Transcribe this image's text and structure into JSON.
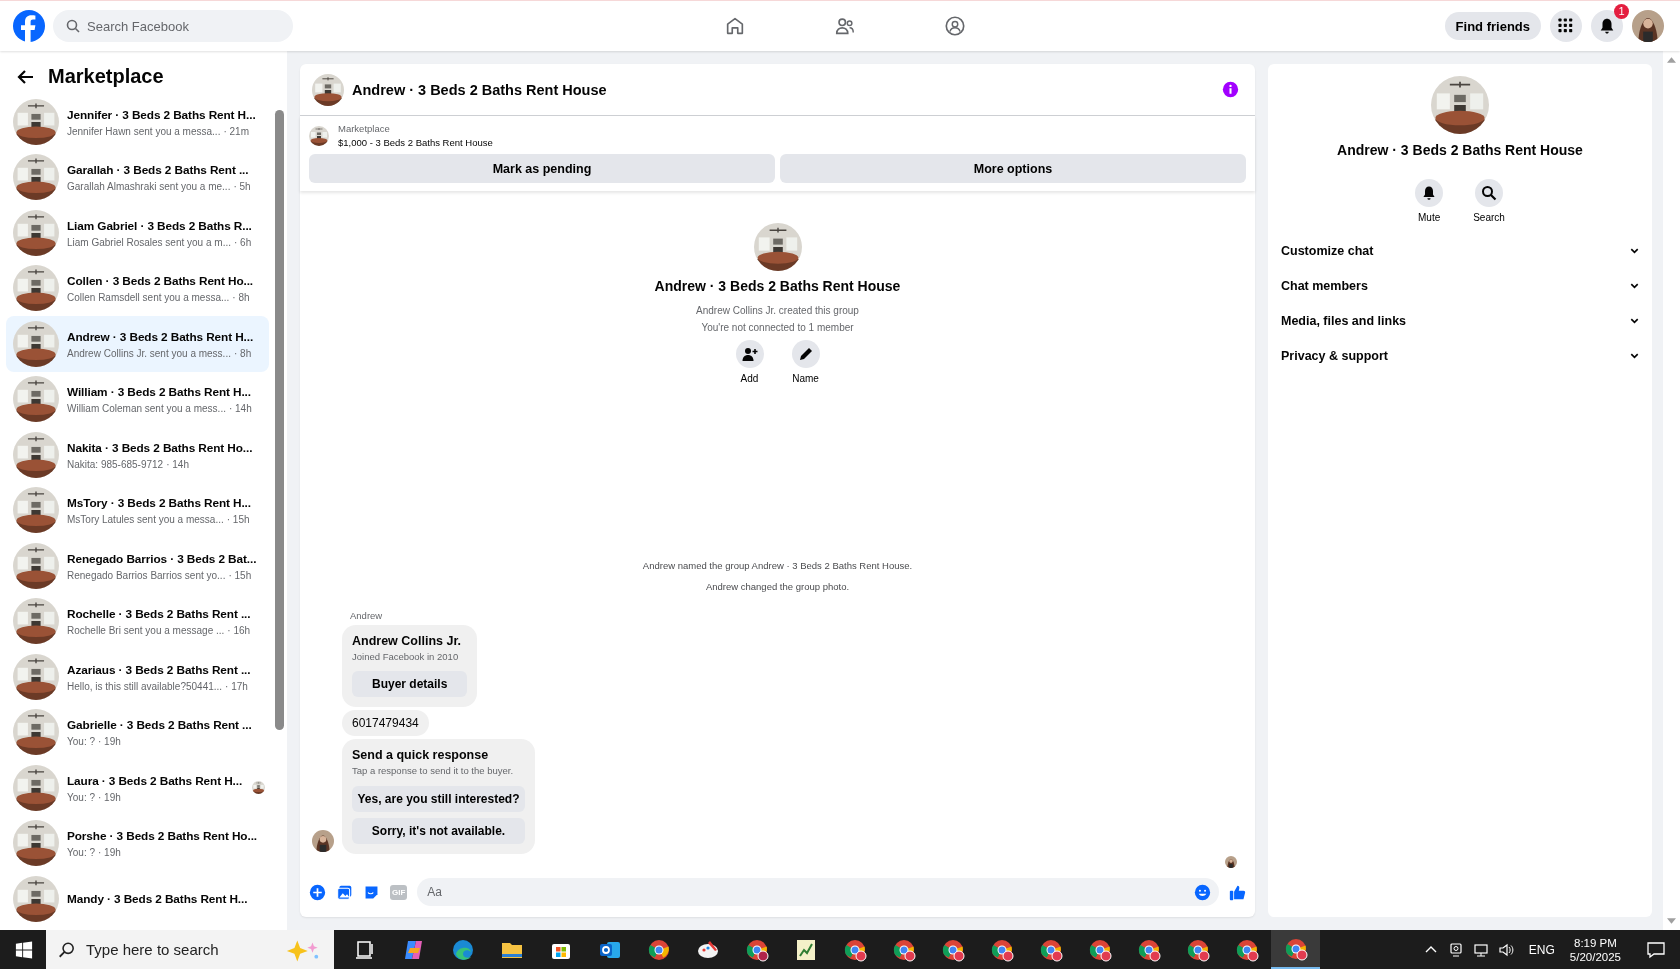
{
  "top_bar": {
    "search": {
      "placeholder": "Search Facebook"
    },
    "find_friends": "Find friends",
    "notification_count": "1"
  },
  "sidebar": {
    "title": "Marketplace",
    "conversations": [
      {
        "name": "Jennifer · 3 Beds 2 Baths Rent H...",
        "preview": "Jennifer Hawn sent you a messa...",
        "time": "· 21m",
        "selected": false,
        "seen_avatar": false
      },
      {
        "name": "Garallah · 3 Beds 2 Baths Rent ...",
        "preview": "Garallah Almashraki sent you a me...",
        "time": "· 5h",
        "selected": false,
        "seen_avatar": false
      },
      {
        "name": "Liam Gabriel · 3 Beds 2 Baths R...",
        "preview": "Liam Gabriel Rosales sent you a m...",
        "time": "· 6h",
        "selected": false,
        "seen_avatar": false
      },
      {
        "name": "Collen · 3 Beds 2 Baths Rent Ho...",
        "preview": "Collen Ramsdell sent you a messa...",
        "time": "· 8h",
        "selected": false,
        "seen_avatar": false
      },
      {
        "name": "Andrew · 3 Beds 2 Baths Rent H...",
        "preview": "Andrew Collins Jr. sent you a mess...",
        "time": "· 8h",
        "selected": true,
        "seen_avatar": false
      },
      {
        "name": "William · 3 Beds 2 Baths Rent H...",
        "preview": "William Coleman sent you a mess...",
        "time": "· 14h",
        "selected": false,
        "seen_avatar": false
      },
      {
        "name": "Nakita · 3 Beds 2 Baths Rent Ho...",
        "preview": "Nakita: 985-685-9712",
        "time": "· 14h",
        "selected": false,
        "seen_avatar": false
      },
      {
        "name": "MsTory · 3 Beds 2 Baths Rent H...",
        "preview": "MsTory Latules sent you a messa...",
        "time": "· 15h",
        "selected": false,
        "seen_avatar": false
      },
      {
        "name": "Renegado Barrios · 3 Beds 2 Bat...",
        "preview": "Renegado Barrios Barrios sent yo...",
        "time": "· 15h",
        "selected": false,
        "seen_avatar": false
      },
      {
        "name": "Rochelle · 3 Beds 2 Baths Rent ...",
        "preview": "Rochelle Bri sent you a message ...",
        "time": "· 16h",
        "selected": false,
        "seen_avatar": false
      },
      {
        "name": "Azariaus · 3 Beds 2 Baths Rent ...",
        "preview": "Hello, is this still available?50441...",
        "time": "· 17h",
        "selected": false,
        "seen_avatar": false
      },
      {
        "name": "Gabrielle · 3 Beds 2 Baths Rent ...",
        "preview": "You: ?",
        "time": "· 19h",
        "selected": false,
        "seen_avatar": false
      },
      {
        "name": "Laura · 3 Beds 2 Baths Rent H...",
        "preview": "You: ?",
        "time": "· 19h",
        "selected": false,
        "seen_avatar": true
      },
      {
        "name": "Porshe · 3 Beds 2 Baths Rent Ho...",
        "preview": "You: ?",
        "time": "· 19h",
        "selected": false,
        "seen_avatar": false
      },
      {
        "name": "Mandy · 3 Beds 2 Baths Rent H...",
        "selected": false,
        "seen_avatar": false
      }
    ]
  },
  "chat": {
    "title": "Andrew · 3 Beds 2 Baths Rent House",
    "listing": {
      "label": "Marketplace",
      "title": "$1,000 - 3 Beds 2 Baths Rent House"
    },
    "listing_actions": [
      "Mark as pending",
      "More options"
    ],
    "intro": {
      "title": "Andrew · 3 Beds 2 Baths Rent House",
      "lines": [
        "Andrew Collins Jr. created this group",
        "You're not connected to 1 member"
      ],
      "actions": [
        {
          "kind": "add",
          "label": "Add"
        },
        {
          "kind": "name",
          "label": "Name"
        }
      ]
    },
    "events": [
      "Andrew named the group Andrew · 3 Beds 2 Baths Rent House.",
      "Andrew changed the group photo."
    ],
    "sender": "Andrew",
    "buyer_card": {
      "name": "Andrew Collins Jr.",
      "subtitle": "Joined Facebook in 2010",
      "button": "Buyer details"
    },
    "phone_message": "6017479434",
    "quick_response": {
      "title": "Send a quick response",
      "hint": "Tap a response to send it to the buyer.",
      "options": [
        "Yes, are you still interested?",
        "Sorry, it's not available."
      ]
    },
    "composer": {
      "placeholder": "Aa",
      "gif_label": "GIF"
    }
  },
  "details": {
    "title": "Andrew · 3 Beds 2 Baths Rent House",
    "actions": [
      {
        "kind": "mute",
        "label": "Mute"
      },
      {
        "kind": "search",
        "label": "Search"
      }
    ],
    "sections": [
      {
        "label": "Customize chat",
        "expanded": false
      },
      {
        "label": "Chat members",
        "expanded": false
      },
      {
        "label": "Media, files and links",
        "expanded": false
      },
      {
        "label": "Privacy & support",
        "expanded": false
      }
    ]
  },
  "taskbar": {
    "search": {
      "placeholder": "Type here to search"
    },
    "language": "ENG",
    "time": "8:19 PM",
    "date": "5/20/2025"
  }
}
